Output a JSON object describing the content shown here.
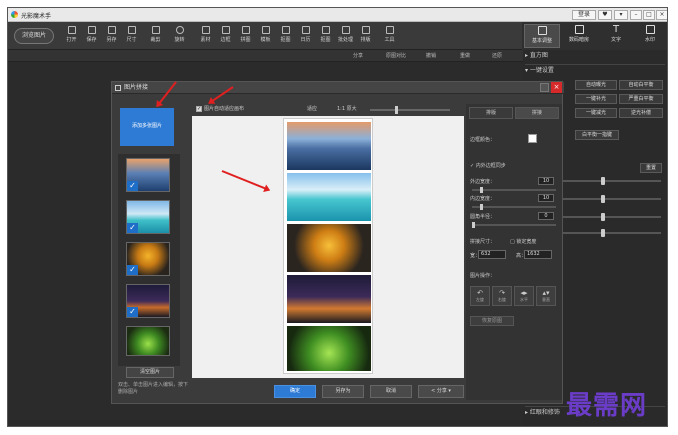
{
  "app": {
    "title": "光影魔术手"
  },
  "titlebar": {
    "login": "登录",
    "min": "–",
    "max": "□",
    "close": "×",
    "menu": "▾",
    "skin": "♥"
  },
  "toolbar": {
    "open_label": "浏览图片",
    "tools": [
      "打开",
      "保存",
      "另存",
      "尺寸",
      "裁剪",
      "旋转",
      "素材",
      "边框",
      "拼图",
      "模板",
      "抠图",
      "日历",
      "抠图",
      "批处理",
      "排版",
      "工具"
    ]
  },
  "right_tabs": [
    {
      "label": "基本调整",
      "icon": "adjust-icon"
    },
    {
      "label": "数码暗房",
      "icon": "camera-icon"
    },
    {
      "label": "文字",
      "icon": "text-icon"
    },
    {
      "label": "水印",
      "icon": "watermark-icon"
    }
  ],
  "subbar": {
    "share": "分享",
    "compare": "原图对比",
    "undo": "撤销",
    "redo": "重做",
    "restore": "还原"
  },
  "right_panel": {
    "histogram": "直方图",
    "one_click": "一键设置",
    "buttons": [
      "自动曝光",
      "自动白平衡",
      "一键补光",
      "严重白平衡",
      "一键减光",
      "逆光补偿",
      "白平衡一指键"
    ],
    "reset": "重置"
  },
  "dialog": {
    "title": "图片拼接",
    "add_button": "添加多张图片",
    "select_button": "清空图片",
    "hint": "双击、单击图片进入编辑，按下删除图片",
    "auto_checkbox": "图片自动适应画布",
    "check_mark": "✓",
    "zoom_fit": "适应",
    "zoom_11": "1:1 原大",
    "save_btn": "确定",
    "saveas_btn": "另存为",
    "cancel_btn": "取消",
    "share_btn": "分享",
    "settings": {
      "tab_layout": "排版",
      "tab_stitch": "拼接",
      "bg_color": "边框颜色：",
      "inner_border": "内外边框同步",
      "outer_width_label": "外边宽度：",
      "outer_width": "10",
      "inner_width_label": "内边宽度：",
      "inner_width": "10",
      "corner_label": "圆角半径：",
      "corner": "0",
      "size_label": "拼接尺寸：",
      "lock_label": "锁定宽度",
      "w_label": "宽：",
      "w": "632",
      "h_label": "高：",
      "h": "1632",
      "ops_label": "图片操作：",
      "ops": [
        "左旋",
        "右旋",
        "水平",
        "垂直"
      ],
      "reset": "恢复原图"
    }
  },
  "bottom_panel": {
    "label": "红眼和修饰"
  },
  "watermark": "最需网",
  "colors": {
    "accent": "#2e7bd6",
    "close": "#d62a2a",
    "arrow": "#e02020",
    "watermark": "#6a3cc8"
  }
}
